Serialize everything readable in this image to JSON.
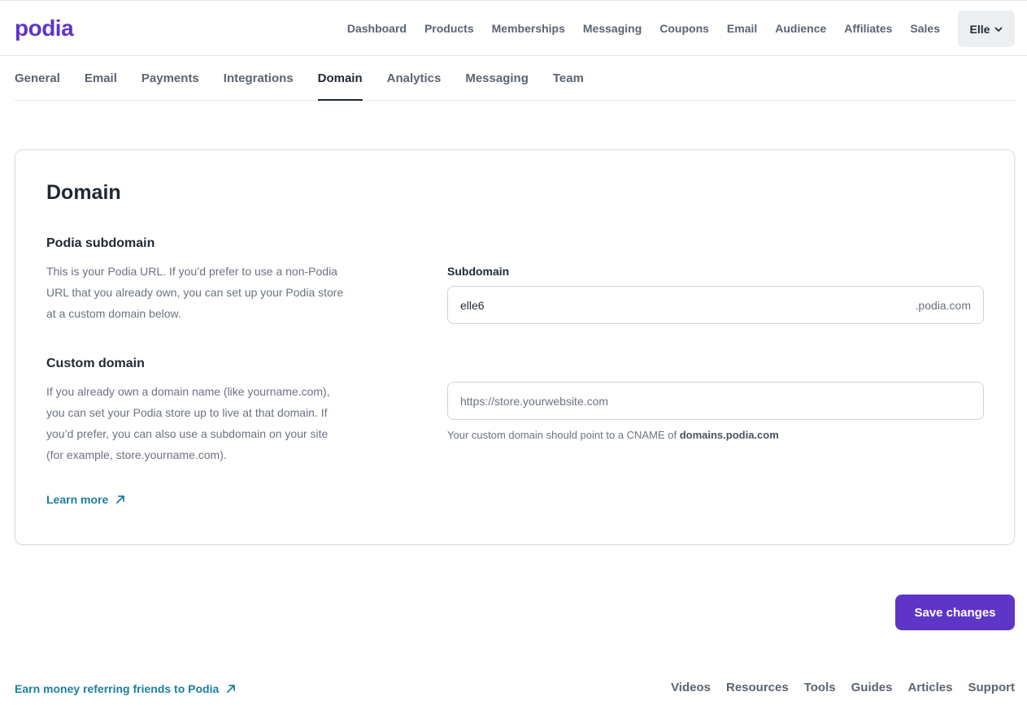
{
  "brand": {
    "logo_text": "podia",
    "color": "#5f35c7"
  },
  "header": {
    "nav": [
      "Dashboard",
      "Products",
      "Memberships",
      "Messaging",
      "Coupons",
      "Email",
      "Audience",
      "Affiliates",
      "Sales"
    ],
    "user": {
      "name": "Elle",
      "icon": "chevron-down-icon"
    }
  },
  "tabs": {
    "items": [
      "General",
      "Email",
      "Payments",
      "Integrations",
      "Domain",
      "Analytics",
      "Messaging",
      "Team"
    ],
    "active": "Domain"
  },
  "card": {
    "title": "Domain",
    "subdomain": {
      "heading": "Podia subdomain",
      "description": "This is your Podia URL. If you’d prefer to use a non-Podia URL that you already own, you can set up your Podia store at a custom domain below.",
      "field_label": "Subdomain",
      "value": "elle6",
      "suffix": ".podia.com"
    },
    "custom": {
      "heading": "Custom domain",
      "description": "If you already own a domain name (like yourname.com), you can set your Podia store up to live at that domain. If you’d prefer, you can also use a subdomain on your site (for example, store.yourname.com).",
      "placeholder": "https://store.yourwebsite.com",
      "hint_prefix": "Your custom domain should point to a CNAME of",
      "hint_value": "domains.podia.com",
      "learn_more": "Learn more",
      "learn_more_icon": "external-arrow-icon"
    }
  },
  "actions": {
    "save_label": "Save changes",
    "color": "#5f35c7"
  },
  "footer": {
    "referral": "Earn money referring friends to Podia",
    "links": [
      "Videos",
      "Resources",
      "Tools",
      "Guides",
      "Articles",
      "Support"
    ],
    "link_color": "#1c7fa0"
  }
}
